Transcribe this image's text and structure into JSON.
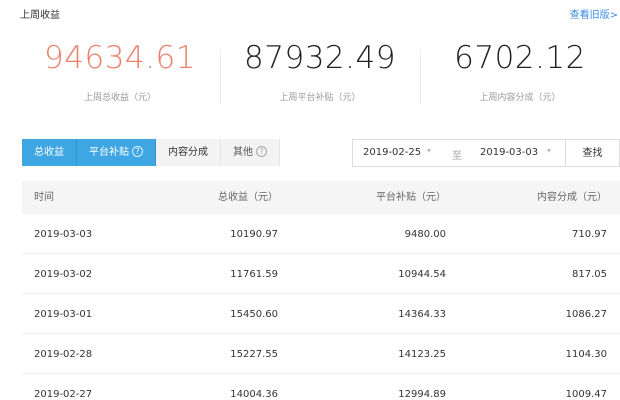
{
  "header": {
    "title": "上周收益",
    "old_version_link": "查看旧版>"
  },
  "stats": [
    {
      "value": "94634.61",
      "label": "上周总收益（元）"
    },
    {
      "value": "87932.49",
      "label": "上周平台补贴（元）"
    },
    {
      "value": "6702.12",
      "label": "上周内容分成（元）"
    }
  ],
  "tabs": [
    {
      "label": "总收益",
      "help": ""
    },
    {
      "label": "平台补贴",
      "help": "?"
    },
    {
      "label": "内容分成",
      "help": ""
    },
    {
      "label": "其他",
      "help": "?"
    }
  ],
  "filter": {
    "start_date": "2019-02-25",
    "end_date": "2019-03-03",
    "separator": "至",
    "search_label": "查找",
    "caret": "▾"
  },
  "table": {
    "columns": [
      "时间",
      "总收益（元）",
      "平台补贴（元）",
      "内容分成（元）"
    ],
    "rows": [
      [
        "2019-03-03",
        "10190.97",
        "9480.00",
        "710.97"
      ],
      [
        "2019-03-02",
        "11761.59",
        "10944.54",
        "817.05"
      ],
      [
        "2019-03-01",
        "15450.60",
        "14364.33",
        "1086.27"
      ],
      [
        "2019-02-28",
        "15227.55",
        "14123.25",
        "1104.30"
      ],
      [
        "2019-02-27",
        "14004.36",
        "12994.89",
        "1009.47"
      ]
    ]
  },
  "colors": {
    "accent_value": "#e8826b",
    "active_tab": "#3ea6e3",
    "link": "#3a8ee6"
  }
}
